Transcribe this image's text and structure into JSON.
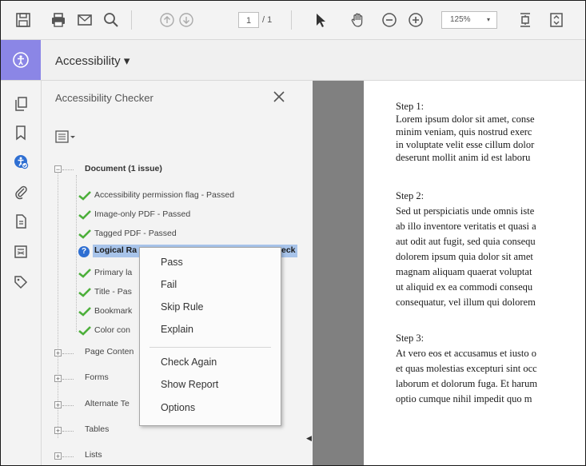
{
  "toolbar": {
    "page_current": "1",
    "page_total": "/ 1",
    "zoom": "125%",
    "zoom_arrow": "▾",
    "icons": [
      "save-icon",
      "print-icon",
      "email-icon",
      "search-icon",
      "page-up-icon",
      "page-down-icon",
      "select-tool-icon",
      "hand-tool-icon",
      "zoom-out-icon",
      "zoom-in-icon",
      "fit-page-icon",
      "scroll-mode-icon"
    ]
  },
  "subbar": {
    "title": "Accessibility ▾"
  },
  "panel": {
    "title": "Accessibility Checker",
    "close": "✕",
    "tree": {
      "document": "Document (1 issue)",
      "children": [
        {
          "label": "Accessibility permission flag - Passed",
          "status": "passed"
        },
        {
          "label": "Image-only PDF - Passed",
          "status": "passed"
        },
        {
          "label": "Tagged PDF - Passed",
          "status": "passed"
        },
        {
          "label": "Logical Ra",
          "label_tail": "eck",
          "status": "needs-check"
        },
        {
          "label": "Primary la",
          "status": "passed"
        },
        {
          "label": "Title - Pas",
          "status": "passed"
        },
        {
          "label": "Bookmark",
          "status": "passed"
        },
        {
          "label": "Color con",
          "status": "passed"
        }
      ],
      "groups": [
        "Page Conten",
        "Forms",
        "Alternate Te",
        "Tables",
        "Lists"
      ]
    }
  },
  "context_menu": {
    "items": [
      "Pass",
      "Fail",
      "Skip Rule",
      "Explain",
      "Check Again",
      "Show Report",
      "Options"
    ]
  },
  "document": {
    "lines": [
      "Step 1:",
      "Lorem ipsum dolor sit amet, conse",
      "minim veniam, quis nostrud exerc",
      "in voluptate velit esse cillum dolor",
      "deserunt mollit anim id est laboru",
      "Step 2:",
      "Sed ut perspiciatis unde omnis iste",
      "ab illo inventore veritatis et quasi a",
      "aut odit aut fugit, sed quia consequ",
      "dolorem ipsum quia dolor sit amet",
      "magnam aliquam quaerat voluptat",
      "ut aliquid ex ea commodi consequ",
      "consequatur, vel illum qui dolorem",
      "Step 3:",
      "At vero eos et accusamus et iusto o",
      "et quas molestias excepturi sint occ",
      "laborum et dolorum fuga. Et harum",
      "optio cumque nihil impedit quo m"
    ]
  },
  "colors": {
    "accent": "#8b86e6",
    "selection": "#a8c4ea",
    "passed": "#4caf3a",
    "needs_check": "#2f6fd2",
    "gutter": "#808080"
  }
}
